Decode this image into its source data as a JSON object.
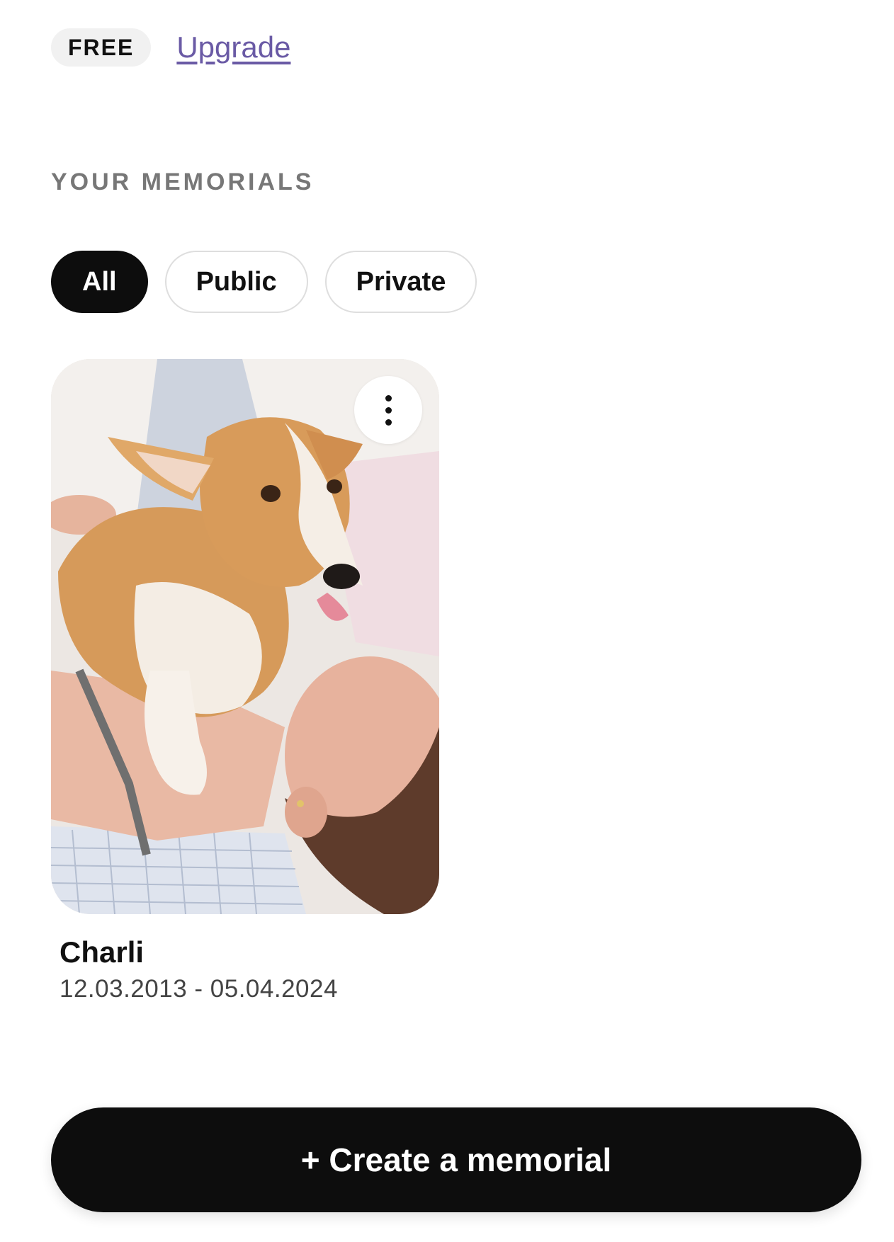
{
  "plan": {
    "badge": "FREE",
    "upgrade_label": "Upgrade"
  },
  "section": {
    "title": "YOUR MEMORIALS"
  },
  "filters": [
    {
      "label": "All",
      "active": true
    },
    {
      "label": "Public",
      "active": false
    },
    {
      "label": "Private",
      "active": false
    }
  ],
  "memorials": [
    {
      "name": "Charli",
      "dates": "12.03.2013 - 05.04.2024",
      "photo_icon": "dog-photo",
      "menu_icon": "more-vertical-icon"
    }
  ],
  "actions": {
    "create_label": "+ Create a memorial"
  },
  "colors": {
    "accent_link": "#6a5aa5",
    "primary_button": "#0d0d0d",
    "chip_border": "#dedede",
    "badge_bg": "#f1f1f1"
  }
}
